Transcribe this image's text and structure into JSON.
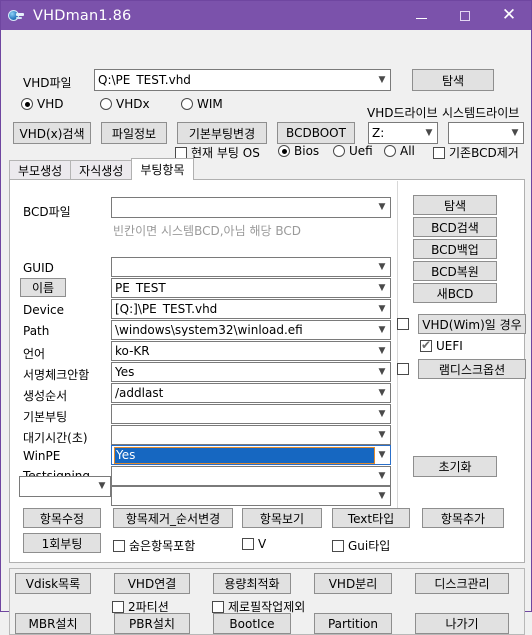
{
  "window": {
    "title": "VHDman1.86",
    "icon": "vhd-globe-icon",
    "titlebar_color": "#7b52ab",
    "minimize": "–",
    "maximize": "□",
    "close": "✕"
  },
  "top": {
    "vhd_file_label": "VHD파일",
    "vhd_file_value": "Q:\\PE_TEST.vhd",
    "browse_button": "탐색",
    "type_radios": [
      {
        "label": "VHD",
        "selected": true
      },
      {
        "label": "VHDx",
        "selected": false
      },
      {
        "label": "WIM",
        "selected": false
      }
    ],
    "vhd_drive_label": "VHD드라이브",
    "system_drive_label": "시스템드라이브",
    "vhd_drive_value": "Z:",
    "system_drive_value": "",
    "buttons": [
      "VHD(x)검색",
      "파일정보",
      "기본부팅변경",
      "BCDBOOT"
    ],
    "current_boot_os": {
      "label": "현재 부팅 OS",
      "checked": false
    },
    "firmware_radios": [
      {
        "label": "Bios",
        "selected": true
      },
      {
        "label": "Uefi",
        "selected": false
      },
      {
        "label": "All",
        "selected": false
      }
    ],
    "remove_bcd": {
      "label": "기존BCD제거",
      "checked": false
    }
  },
  "tabs": [
    {
      "label": "부모생성",
      "active": false
    },
    {
      "label": "자식생성",
      "active": false
    },
    {
      "label": "부팅항목",
      "active": true
    }
  ],
  "form": {
    "bcd_file_label": "BCD파일",
    "bcd_file_value": "",
    "bcd_hint": "빈칸이면 시스템BCD,아님 해당 BCD",
    "fields": [
      {
        "label": "GUID",
        "value": "",
        "is_button_label": false,
        "focused": false
      },
      {
        "label": "이름",
        "value": "PE_TEST",
        "is_button_label": true,
        "focused": false
      },
      {
        "label": "Device",
        "value": "[Q:]\\PE_TEST.vhd",
        "is_button_label": false,
        "focused": false
      },
      {
        "label": "Path",
        "value": "\\windows\\system32\\winload.efi",
        "is_button_label": false,
        "focused": false
      },
      {
        "label": "언어",
        "value": "ko-KR",
        "is_button_label": false,
        "focused": false
      },
      {
        "label": "서명체크안함",
        "value": "Yes",
        "is_button_label": false,
        "focused": false
      },
      {
        "label": "생성순서",
        "value": "/addlast",
        "is_button_label": false,
        "focused": false
      },
      {
        "label": "기본부팅",
        "value": "",
        "is_button_label": false,
        "focused": false
      },
      {
        "label": "대기시간(초)",
        "value": "",
        "is_button_label": false,
        "focused": false
      },
      {
        "label": "WinPE",
        "value": "Yes",
        "is_button_label": false,
        "focused": true
      },
      {
        "label": "Testsigning",
        "value": "",
        "is_button_label": false,
        "focused": false
      }
    ],
    "extra_left_combo": "",
    "extra_right_combo": ""
  },
  "sidepanel": {
    "buttons": [
      "탐색",
      "BCD검색",
      "BCD백업",
      "BCD복원",
      "새BCD"
    ],
    "vhd_wim_case": {
      "label": "VHD(Wim)일 경우",
      "checked": false
    },
    "uefi": {
      "label": "UEFI",
      "checked": true
    },
    "ramdisk": {
      "label": "램디스크옵션",
      "checked": false
    },
    "reset_button": "초기화"
  },
  "action_rows": {
    "row1": [
      "항목수정",
      "항목제거_순서변경",
      "항목보기",
      "Text타입",
      "항목추가"
    ],
    "once_boot_button": "1회부팅",
    "checkboxes": [
      {
        "label": "숨은항목포함",
        "checked": false
      },
      {
        "label": "V",
        "checked": false
      },
      {
        "label": "Gui타입",
        "checked": false
      }
    ]
  },
  "bottom": {
    "row1": [
      "Vdisk목록",
      "VHD연결",
      "용량최적화",
      "VHD분리",
      "디스크관리"
    ],
    "checkboxes": [
      {
        "label": "2파티션",
        "checked": false
      },
      {
        "label": "제로필작업제외",
        "checked": false
      }
    ],
    "row2": [
      "MBR설치",
      "PBR설치",
      "BootIce",
      "Partition",
      "나가기"
    ]
  }
}
